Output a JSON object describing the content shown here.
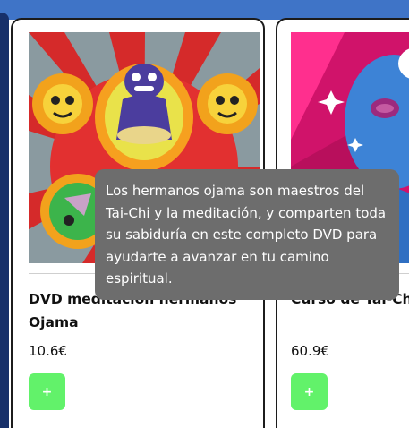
{
  "products": [
    {
      "title": "DVD meditación hermanos Ojama",
      "price": "10.6€",
      "add_label": "+",
      "image_alt": "Ilustración de los hermanos Ojama meditando"
    },
    {
      "title": "Curso de Tai-Chi profesor Ojama",
      "price": "60.9€",
      "add_label": "+",
      "image_alt": "Ilustración del profesor Ojama"
    }
  ],
  "tooltip": {
    "text": "Los hermanos ojama son maestros del Tai-Chi y la meditación, y comparten toda su sabiduría en este completo DVD para ayudarte a avanzar en tu camino espiritual."
  },
  "colors": {
    "page_band": "#3f74c7",
    "card_border": "#1c1c1c",
    "add_button": "#62f26a",
    "tooltip_bg": "#6d6d6d"
  }
}
